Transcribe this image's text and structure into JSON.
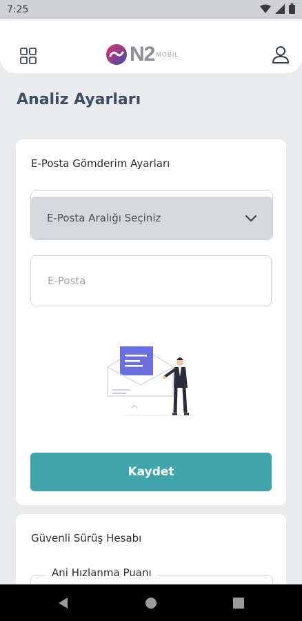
{
  "status_bar": {
    "time": "7:25"
  },
  "app_bar": {
    "logo_text": "N2",
    "logo_subtext": "MOBIL"
  },
  "page": {
    "title": "Analiz Ayarları"
  },
  "email_card": {
    "title": "E-Posta Gömderim Ayarları",
    "select_value": "E-Posta Aralığı Seçiniz",
    "email_placeholder": "E-Posta",
    "save_label": "Kaydet"
  },
  "safe_drive_card": {
    "title": "Güvenli Sürüş Hesabı",
    "field_label": "Ani Hızlanma Puanı"
  },
  "colors": {
    "accent": "#3fa4ab",
    "title": "#3e4e63"
  }
}
